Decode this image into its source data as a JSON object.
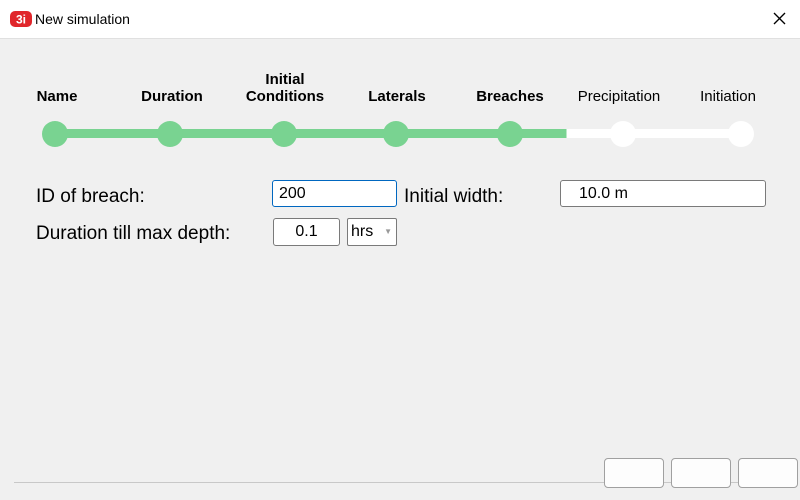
{
  "window": {
    "title": "New simulation"
  },
  "steps": [
    {
      "label": "Name",
      "done": true
    },
    {
      "label": "Duration",
      "done": true
    },
    {
      "label": "Initial Conditions",
      "done": true
    },
    {
      "label": "Laterals",
      "done": true
    },
    {
      "label": "Breaches",
      "done": true
    },
    {
      "label": "Precipitation",
      "done": false
    },
    {
      "label": "Initiation",
      "done": false
    }
  ],
  "form": {
    "breach_id_label": "ID of breach:",
    "breach_id_value": "200",
    "initial_width_label": "Initial width:",
    "initial_width_value": "10.0 m",
    "duration_label": "Duration till max depth:",
    "duration_value": "0.1",
    "duration_unit": "hrs"
  },
  "colors": {
    "progress_done": "#79d391",
    "progress_todo": "#ffffff",
    "focus": "#0067c0",
    "logo": "#e0262b"
  },
  "icons": {
    "app": "3di-logo",
    "close": "close-icon"
  }
}
